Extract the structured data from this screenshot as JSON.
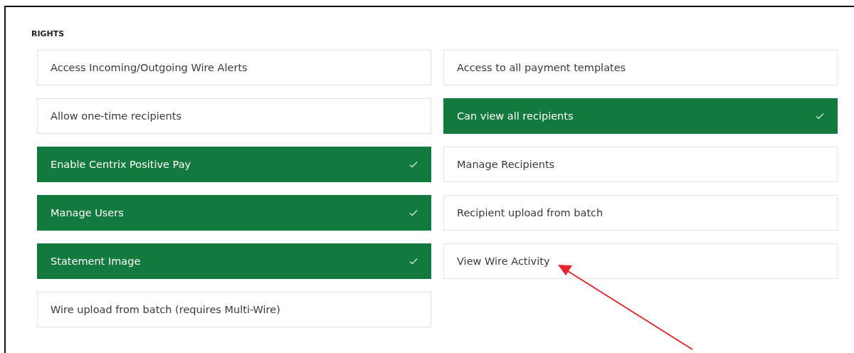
{
  "section": {
    "title": "RIGHTS"
  },
  "rights": [
    {
      "label": "Access Incoming/Outgoing Wire Alerts",
      "checked": false
    },
    {
      "label": "Access to all payment templates",
      "checked": false
    },
    {
      "label": "Allow one-time recipients",
      "checked": false
    },
    {
      "label": "Can view all recipients",
      "checked": true
    },
    {
      "label": "Enable Centrix Positive Pay",
      "checked": true
    },
    {
      "label": "Manage Recipients",
      "checked": false
    },
    {
      "label": "Manage Users",
      "checked": true
    },
    {
      "label": "Recipient upload from batch",
      "checked": false
    },
    {
      "label": "Statement Image",
      "checked": true
    },
    {
      "label": "View Wire Activity",
      "checked": false
    },
    {
      "label": "Wire upload from batch (requires Multi-Wire)",
      "checked": false
    }
  ]
}
